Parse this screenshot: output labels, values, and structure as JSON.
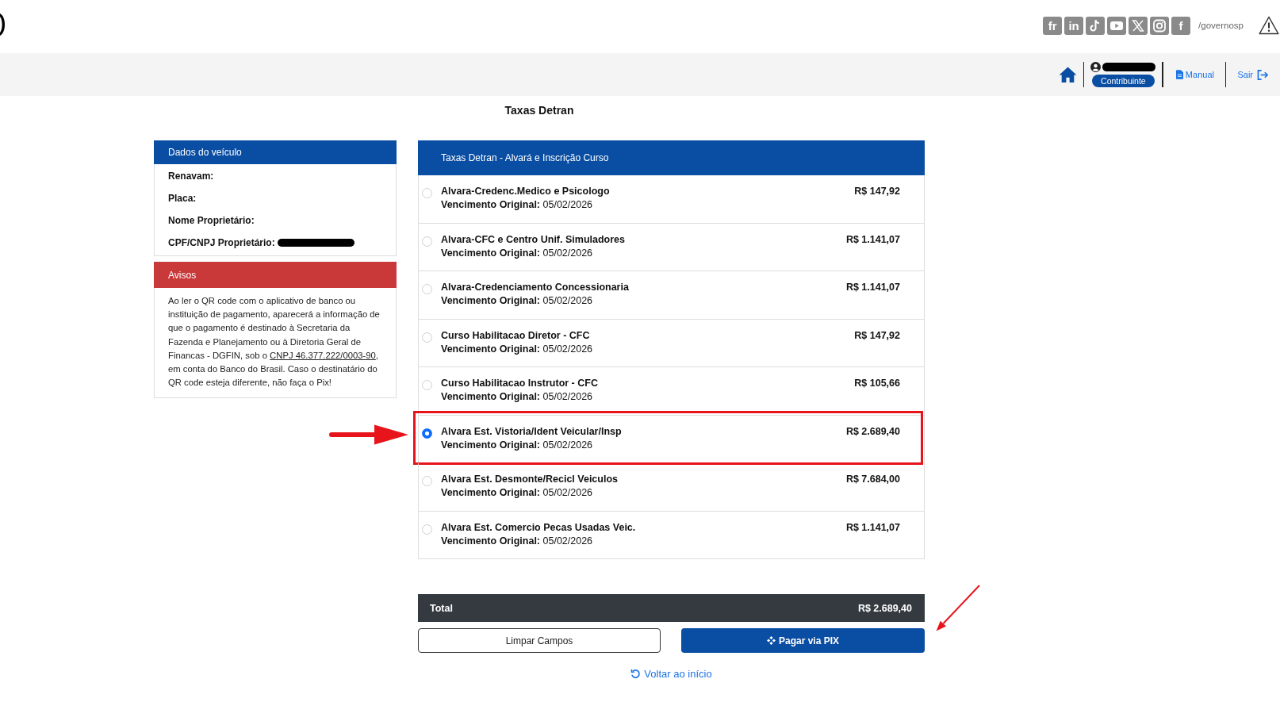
{
  "header": {
    "social_links": [
      {
        "kind": "text",
        "label": "fr"
      },
      {
        "kind": "text",
        "label": "in"
      },
      {
        "kind": "note"
      },
      {
        "kind": "play"
      },
      {
        "kind": "x"
      },
      {
        "kind": "camera"
      },
      {
        "kind": "text",
        "label": "f"
      }
    ],
    "handle": "/governosp"
  },
  "nav": {
    "user": {
      "name_redacted": true,
      "role": "Contribuinte"
    },
    "links": [
      {
        "kind": "manual",
        "label": "Manual"
      },
      {
        "kind": "logout",
        "label": "Sair"
      }
    ]
  },
  "page_title": "Taxas Detran",
  "vehicle_panel": {
    "title": "Dados do veículo",
    "fields": [
      {
        "label": "Renavam:",
        "redacted": false
      },
      {
        "label": "Placa:",
        "redacted": false
      },
      {
        "label": "Nome Proprietário:",
        "redacted": false
      },
      {
        "label": "CPF/CNPJ Proprietário:",
        "redacted": true
      }
    ]
  },
  "notice_panel": {
    "title": "Avisos",
    "text_before": "Ao ler o QR code com o aplicativo de banco ou instituição de pagamento, aparecerá a informação de que o pagamento é destinado à Secretaria da Fazenda e Planejamento ou à Diretoria Geral de Financas - DGFIN, sob o ",
    "link": "CNPJ 46.377.222/0003-90",
    "text_after": ", em conta do Banco do Brasil. Caso o destinatário do QR code esteja diferente, não faça o Pix!"
  },
  "fees_panel": {
    "title": "Taxas Detran - Alvará e Inscrição Curso",
    "items": [
      {
        "name": "Alvara-Credenc.Medico e Psicologo",
        "due": "**Vencimento Original:** 05/02/2026",
        "price": "R$ 147,92",
        "selected": false,
        "highlighted": false
      },
      {
        "name": "Alvara-CFC e Centro Unif. Simuladores",
        "due": "**Vencimento Original:** 05/02/2026",
        "price": "R$ 1.141,07",
        "selected": false,
        "highlighted": false
      },
      {
        "name": "Alvara-Credenciamento Concessionaria",
        "due": "**Vencimento Original:** 05/02/2026",
        "price": "R$ 1.141,07",
        "selected": false,
        "highlighted": false
      },
      {
        "name": "Curso Habilitacao Diretor - CFC",
        "due": "**Vencimento Original:** 05/02/2026",
        "price": "R$ 147,92",
        "selected": false,
        "highlighted": false
      },
      {
        "name": "Curso Habilitacao Instrutor - CFC",
        "due": "**Vencimento Original:** 05/02/2026",
        "price": "R$ 105,66",
        "selected": false,
        "highlighted": false
      },
      {
        "name": "Alvara Est. Vistoria/Ident Veicular/Insp",
        "due": "**Vencimento Original:** 05/02/2026",
        "price": "R$ 2.689,40",
        "selected": true,
        "highlighted": true
      },
      {
        "name": "Alvara Est. Desmonte/Recicl Veiculos",
        "due": "**Vencimento Original:** 05/02/2026",
        "price": "R$ 7.684,00",
        "selected": false,
        "highlighted": false
      },
      {
        "name": "Alvara Est. Comercio Pecas Usadas Veic.",
        "due": "**Vencimento Original:** 05/02/2026",
        "price": "R$ 1.141,07",
        "selected": false,
        "highlighted": false
      }
    ]
  },
  "total": {
    "label": "Total",
    "value": "R$ 2.689,40"
  },
  "buttons": [
    {
      "kind": "outline",
      "label": "Limpar Campos",
      "highlighted": false
    },
    {
      "kind": "pix",
      "label": "Pagar via PIX",
      "highlighted": true
    }
  ],
  "back_link": "Voltar ao início"
}
